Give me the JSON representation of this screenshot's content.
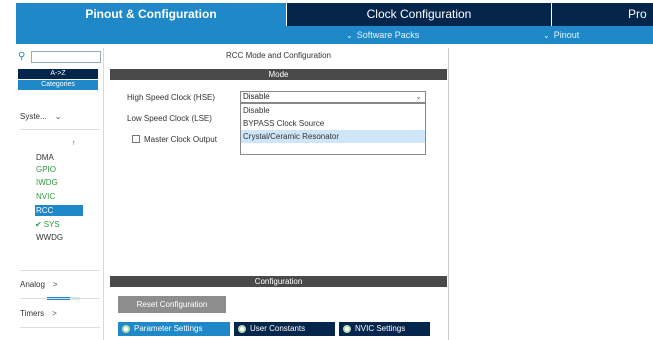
{
  "top_tabs": {
    "pinout": "Pinout & Configuration",
    "clock": "Clock Configuration",
    "project": "Pro"
  },
  "sub_menu": {
    "software_packs": "Software Packs",
    "pinout": "Pinout"
  },
  "sidebar": {
    "search_placeholder": "",
    "az_label": "A->Z",
    "categories_label": "Categories",
    "system_group": "Syste...",
    "items": [
      {
        "label": "DMA"
      },
      {
        "label": "GPIO"
      },
      {
        "label": "IWDG"
      },
      {
        "label": "NVIC"
      },
      {
        "label": "RCC"
      },
      {
        "label": "SYS"
      },
      {
        "label": "WWDG"
      }
    ],
    "analog_group": "Analog",
    "timers_group": "Timers",
    "scroll_progress": 0.7
  },
  "panel": {
    "title": "RCC Mode and Configuration",
    "mode_header": "Mode",
    "hse_label": "High Speed Clock (HSE)",
    "hse_value": "Disable",
    "lse_label": "Low Speed Clock (LSE)",
    "mco_label": "Master Clock Output",
    "dropdown_options": [
      "Disable",
      "BYPASS Clock Source",
      "Crystal/Ceramic Resonator"
    ],
    "config_header": "Configuration",
    "reset_button": "Reset Configuration",
    "param_tabs": [
      "Parameter Settings",
      "User Constants",
      "NVIC Settings"
    ]
  },
  "colors": {
    "accent": "#1e88c8",
    "dark": "#04264c",
    "green": "#2e9a3e"
  }
}
